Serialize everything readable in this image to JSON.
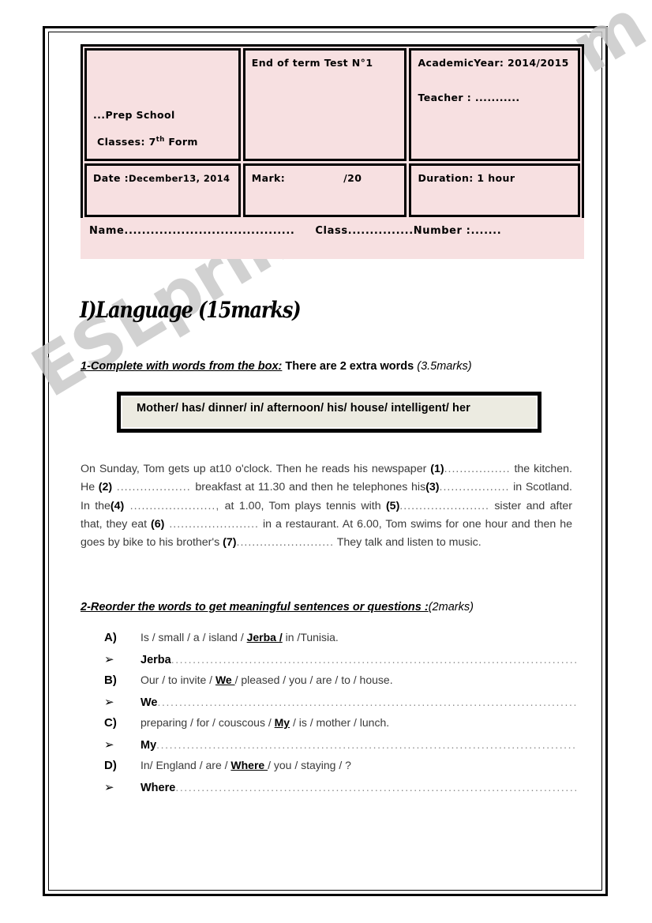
{
  "watermark": {
    "text": "ESLprintables.com"
  },
  "header": {
    "school": "...Prep School",
    "classes_prefix": "Classes: 7",
    "classes_sup": "th",
    "classes_suffix": " Form",
    "test_title": "End of term Test N°1",
    "academic_year": "AcademicYear: 2014/2015",
    "teacher": "Teacher : ...........",
    "date": "Date :",
    "date_value": "December13, 2014",
    "mark_label": "Mark:",
    "mark_value": "/20",
    "duration": "Duration: 1 hour",
    "name_label": "Name.......................................",
    "class_label": "Class...............Number :.......",
    "fill_color": "#f7e0e1"
  },
  "section": {
    "title": "I)Language (15marks)"
  },
  "exercise1": {
    "instruction_lead": "1-Complete with words from the box:",
    "instruction_mid": " There are 2 extra words ",
    "instruction_marks": "(3.5marks)",
    "word_box": "Mother/ has/ dinner/ in/ afternoon/  his/ house/ intelligent/ her",
    "word_box_fill": "#ecebe1",
    "passage_parts": [
      {
        "type": "text",
        "value": "On Sunday, Tom gets up at10 o'clock. Then he reads his newspaper "
      },
      {
        "type": "num",
        "value": "(1)"
      },
      {
        "type": "dots",
        "value": "................."
      },
      {
        "type": "text",
        "value": " the kitchen. He "
      },
      {
        "type": "num",
        "value": "(2)"
      },
      {
        "type": "dots",
        "value": " ................... "
      },
      {
        "type": "text",
        "value": "breakfast at 11.30 and then he telephones his"
      },
      {
        "type": "num",
        "value": "(3)"
      },
      {
        "type": "dots",
        "value": ".................."
      },
      {
        "type": "text",
        "value": " in Scotland.  In the"
      },
      {
        "type": "num",
        "value": "(4)"
      },
      {
        "type": "dots",
        "value": " ......................,"
      },
      {
        "type": "text",
        "value": " at 1.00, Tom plays tennis with "
      },
      {
        "type": "num",
        "value": "(5)"
      },
      {
        "type": "dots",
        "value": "......................."
      },
      {
        "type": "text",
        "value": " sister and after that, they eat "
      },
      {
        "type": "num",
        "value": "(6)"
      },
      {
        "type": "dots",
        "value": " ......................."
      },
      {
        "type": "text",
        "value": " in a restaurant. At 6.00, Tom swims for one hour and then he goes by bike to his brother's "
      },
      {
        "type": "num",
        "value": "(7)"
      },
      {
        "type": "dots",
        "value": "........................."
      },
      {
        "type": "text",
        "value": " They talk and listen to music."
      }
    ]
  },
  "exercise2": {
    "instruction_lead": "2-Reorder the words to get meaningful sentences or questions :",
    "instruction_marks": "(2marks)",
    "items": [
      {
        "label": "A)",
        "words_before": "Is  /  small    / a   /   island    /  ",
        "words_bold": "Jerba  /",
        "words_after": "   in  /Tunisia.",
        "arrow": "➢",
        "answer_start": "Jerba",
        "answer_dots": "................................................................................................."
      },
      {
        "label": "B)",
        "words_before": "Our   /  to invite  / ",
        "words_bold": "We ",
        "words_after": "/  pleased /   you /  are  /  to  /    house.",
        "arrow": "➢",
        "answer_start": "We",
        "answer_dots": "................................................................................................."
      },
      {
        "label": "C)",
        "words_before": "preparing  /     for    /  couscous /   ",
        "words_bold": "My",
        "words_after": " /  is /  mother   /   lunch.",
        "arrow": "➢",
        "answer_start": "My",
        "answer_dots": "................................................................................................."
      },
      {
        "label": "D)",
        "words_before": "In/ England   /   are   /   ",
        "words_bold": "Where ",
        "words_after": "/      you      /     staying / ?",
        "arrow": "➢",
        "answer_start": "Where",
        "answer_dots": "................................................................................................."
      }
    ]
  }
}
